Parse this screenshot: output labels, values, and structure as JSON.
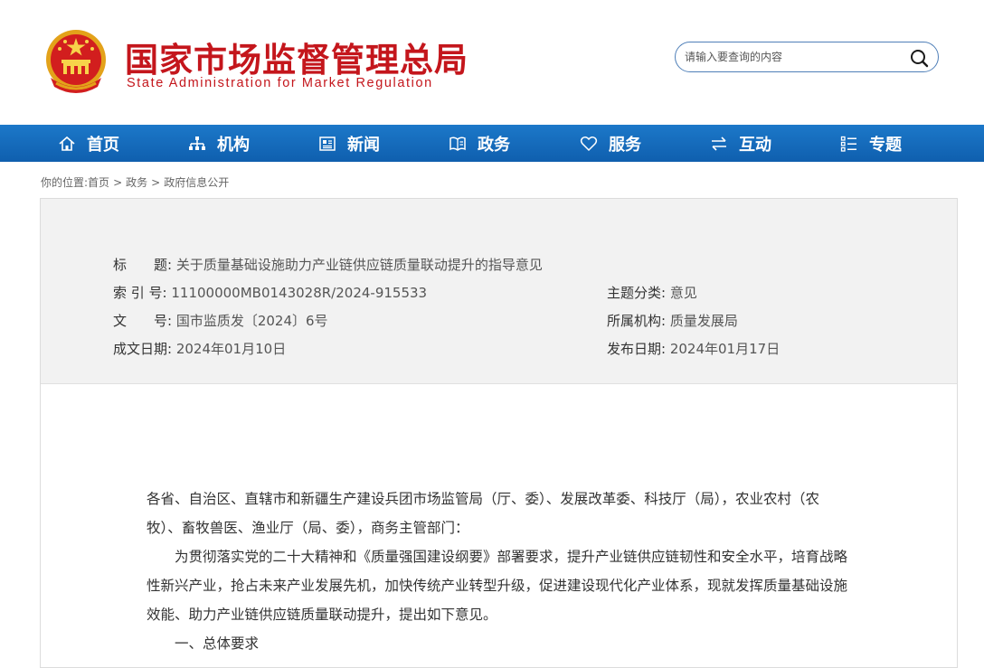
{
  "header": {
    "title": "国家市场监督管理总局",
    "subtitle": "State Administration for Market Regulation",
    "emblem_icon": "national-emblem-icon",
    "brand_color": "#c4161c"
  },
  "search": {
    "placeholder": "请输入要查询的内容",
    "icon": "search-icon"
  },
  "nav": {
    "color": "#1566b8",
    "items": [
      {
        "label": "首页",
        "icon": "home-icon"
      },
      {
        "label": "机构",
        "icon": "org-chart-icon"
      },
      {
        "label": "新闻",
        "icon": "newspaper-icon"
      },
      {
        "label": "政务",
        "icon": "book-icon"
      },
      {
        "label": "服务",
        "icon": "heart-icon"
      },
      {
        "label": "互动",
        "icon": "exchange-arrows-icon"
      },
      {
        "label": "专题",
        "icon": "list-icon"
      }
    ]
  },
  "breadcrumb": {
    "prefix": "你的位置:",
    "items": [
      "首页",
      "政务",
      "政府信息公开"
    ],
    "separator": ">"
  },
  "meta": {
    "title_label": "标　　题:",
    "title_value": "关于质量基础设施助力产业链供应链质量联动提升的指导意见",
    "index_label": "索 引 号:",
    "index_value": "11100000MB0143028R/2024-915533",
    "docno_label": "文　　号:",
    "docno_value": "国市监质发〔2024〕6号",
    "created_label": "成文日期:",
    "created_value": "2024年01月10日",
    "category_label": "主题分类:",
    "category_value": "意见",
    "agency_label": "所属机构:",
    "agency_value": "质量发展局",
    "published_label": "发布日期:",
    "published_value": "2024年01月17日"
  },
  "body": {
    "para1": "各省、自治区、直辖市和新疆生产建设兵团市场监管局（厅、委）、发展改革委、科技厅（局），农业农村（农牧）、畜牧兽医、渔业厅（局、委），商务主管部门：",
    "para2": "为贯彻落实党的二十大精神和《质量强国建设纲要》部署要求，提升产业链供应链韧性和安全水平，培育战略性新兴产业，抢占未来产业发展先机，加快传统产业转型升级，促进建设现代化产业体系，现就发挥质量基础设施效能、助力产业链供应链质量联动提升，提出如下意见。",
    "heading1": "一、总体要求"
  }
}
